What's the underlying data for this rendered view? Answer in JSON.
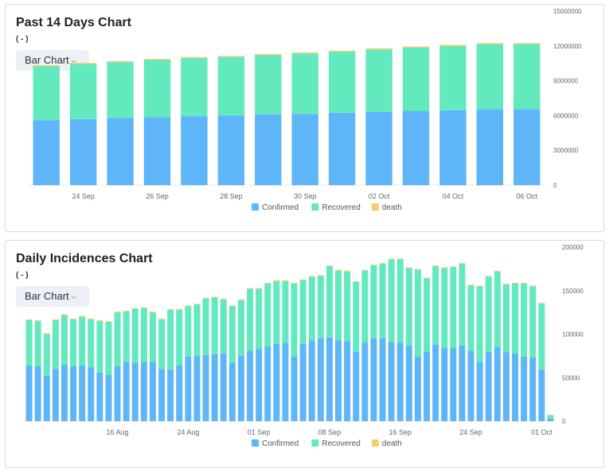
{
  "colors": {
    "confirmed": "#5eb6f9",
    "recovered": "#63e9be",
    "death": "#f3cd6a"
  },
  "charts": [
    {
      "title": "Past 14 Days Chart",
      "subtitle": "( - )",
      "chart_type_label": "Bar Chart"
    },
    {
      "title": "Daily Incidences Chart",
      "subtitle": "( - )",
      "chart_type_label": "Bar Chart"
    }
  ],
  "chart_data": [
    {
      "type": "bar",
      "stacked": true,
      "title": "Past 14 Days Chart",
      "ylim": [
        0,
        15000000
      ],
      "y_ticks": [
        0,
        3000000,
        6000000,
        9000000,
        12000000,
        15000000
      ],
      "x_tick_labels": [
        "24 Sep",
        "26 Sep",
        "28 Sep",
        "30 Sep",
        "02 Oct",
        "04 Oct",
        "06 Oct"
      ],
      "x_tick_indices": [
        1,
        3,
        5,
        7,
        9,
        11,
        13
      ],
      "legend": [
        "Confirmed",
        "Recovered",
        "death"
      ],
      "legend_position": "bottom",
      "series": [
        {
          "name": "Confirmed",
          "values": [
            5600000,
            5700000,
            5800000,
            5850000,
            5950000,
            6000000,
            6100000,
            6150000,
            6250000,
            6300000,
            6400000,
            6450000,
            6550000,
            6550000
          ]
        },
        {
          "name": "Recovered",
          "values": [
            4650000,
            4750000,
            4800000,
            4950000,
            5000000,
            5050000,
            5100000,
            5200000,
            5250000,
            5400000,
            5450000,
            5550000,
            5600000,
            5600000
          ]
        },
        {
          "name": "death",
          "values": [
            86000,
            87000,
            88000,
            89000,
            90000,
            91000,
            92000,
            93000,
            94000,
            95000,
            96000,
            97000,
            98000,
            99000
          ]
        }
      ]
    },
    {
      "type": "bar",
      "stacked": true,
      "title": "Daily Incidences Chart",
      "ylim": [
        0,
        200000
      ],
      "y_ticks": [
        0,
        50000,
        100000,
        150000,
        200000
      ],
      "x_tick_labels": [
        "16 Aug",
        "24 Aug",
        "01 Sep",
        "08 Sep",
        "16 Sep",
        "24 Sep",
        "01 Oct"
      ],
      "x_tick_indices": [
        10,
        18,
        26,
        34,
        42,
        50,
        58
      ],
      "legend": [
        "Confirmed",
        "Recovered",
        "death"
      ],
      "legend_position": "bottom",
      "series": [
        {
          "name": "Confirmed",
          "values": [
            64000,
            63000,
            52000,
            60000,
            65000,
            63000,
            64000,
            62000,
            56000,
            53000,
            63000,
            68000,
            67000,
            68000,
            68000,
            60000,
            59000,
            64000,
            74000,
            75000,
            76000,
            77000,
            78000,
            67000,
            75000,
            81000,
            83000,
            86000,
            89000,
            90000,
            74000,
            89000,
            93000,
            95000,
            96000,
            93000,
            92000,
            80000,
            90000,
            95000,
            95000,
            91000,
            90000,
            87000,
            74000,
            80000,
            88000,
            84000,
            84000,
            87000,
            81000,
            68000,
            79000,
            85000,
            79000,
            78000,
            74000,
            73000,
            59000,
            3000
          ]
        },
        {
          "name": "Recovered",
          "values": [
            52000,
            52000,
            48000,
            56000,
            57000,
            54000,
            56000,
            55000,
            59000,
            61000,
            62000,
            58000,
            62000,
            62000,
            57000,
            57000,
            69000,
            64000,
            58000,
            59000,
            65000,
            65000,
            62000,
            65000,
            64000,
            71000,
            69000,
            72000,
            72000,
            71000,
            84000,
            73000,
            73000,
            72000,
            82000,
            80000,
            80000,
            80000,
            83000,
            84000,
            86000,
            95000,
            96000,
            89000,
            100000,
            84000,
            90000,
            92000,
            93000,
            94000,
            75000,
            87000,
            87000,
            87000,
            78000,
            80000,
            84000,
            82000,
            76000,
            4000
          ]
        },
        {
          "name": "death",
          "values": [
            900,
            900,
            900,
            900,
            900,
            900,
            900,
            900,
            900,
            900,
            900,
            900,
            900,
            900,
            900,
            900,
            900,
            900,
            900,
            900,
            900,
            900,
            900,
            900,
            900,
            900,
            900,
            900,
            900,
            900,
            900,
            900,
            900,
            900,
            900,
            900,
            900,
            900,
            900,
            900,
            900,
            900,
            900,
            900,
            900,
            900,
            900,
            900,
            900,
            900,
            900,
            900,
            900,
            900,
            900,
            900,
            900,
            900,
            900,
            200
          ]
        }
      ]
    }
  ]
}
